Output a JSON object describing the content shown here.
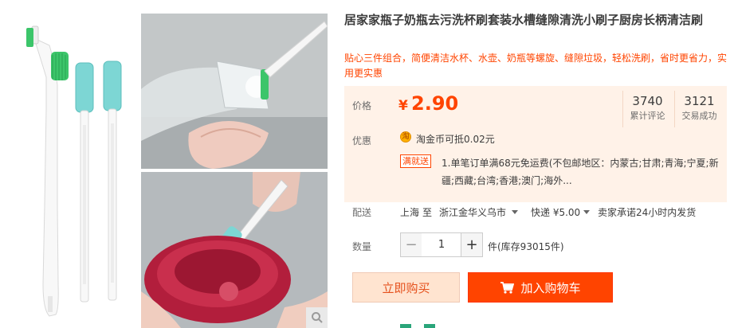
{
  "product": {
    "title": "居家家瓶子奶瓶去污洗杯刷套装水槽缝隙清洗小刷子厨房长柄清洁刷",
    "subtitle": "贴心三件组合，简便清洁水杯、水壶、奶瓶等螺旋、缝隙垃圾，轻松洗刷，省时更省力，实用更实惠"
  },
  "gallery": {
    "zoom_icon": "search-icon"
  },
  "price": {
    "label": "价格",
    "currency": "¥",
    "value": "2.90",
    "stats": [
      {
        "value": "3740",
        "label": "累计评论"
      },
      {
        "value": "3121",
        "label": "交易成功"
      }
    ]
  },
  "promo": {
    "label": "优惠",
    "coin_icon_text": "淘",
    "coin_text": "淘金币可抵",
    "coin_amount": "0.02",
    "coin_unit": "元",
    "badge": "满就送",
    "shipping_note": "1.单笔订单满68元免运费(不包邮地区：内蒙古;甘肃;青海;宁夏;新疆;西藏;台湾;香港;澳门;海外..."
  },
  "delivery": {
    "label": "配送",
    "from": "上海",
    "to_word": "至",
    "destination": "浙江金华义乌市",
    "express": "快递 ¥5.00",
    "promise": "卖家承诺24小时内发货"
  },
  "quantity": {
    "label": "数量",
    "minus": "−",
    "plus": "+",
    "value": "1",
    "stock": "件(库存93015件)"
  },
  "actions": {
    "buy_now": "立即购买",
    "add_to_cart": "加入购物车"
  },
  "colors": {
    "accent": "#ff4400",
    "price": "#ff4400",
    "panel": "#fff2e8"
  }
}
